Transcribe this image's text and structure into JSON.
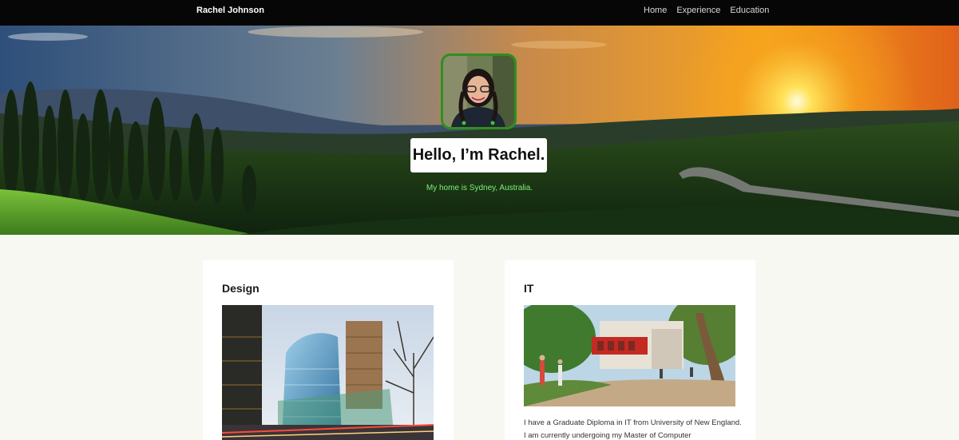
{
  "nav": {
    "brand": "Rachel Johnson",
    "links": [
      "Home",
      "Experience",
      "Education"
    ]
  },
  "hero": {
    "greeting": "Hello, I’m Rachel.",
    "tagline": "My home is Sydney, Australia."
  },
  "cards": [
    {
      "title": "Design"
    },
    {
      "title": "IT",
      "text": "I have a Graduate Diploma in IT from University of New England. I am currently undergoing my Master of Computer"
    }
  ],
  "colors": {
    "navbar_bg": "#060606",
    "page_bg": "#f8f8f3",
    "avatar_border": "#2e8f1e",
    "tagline": "#7cf07a"
  }
}
